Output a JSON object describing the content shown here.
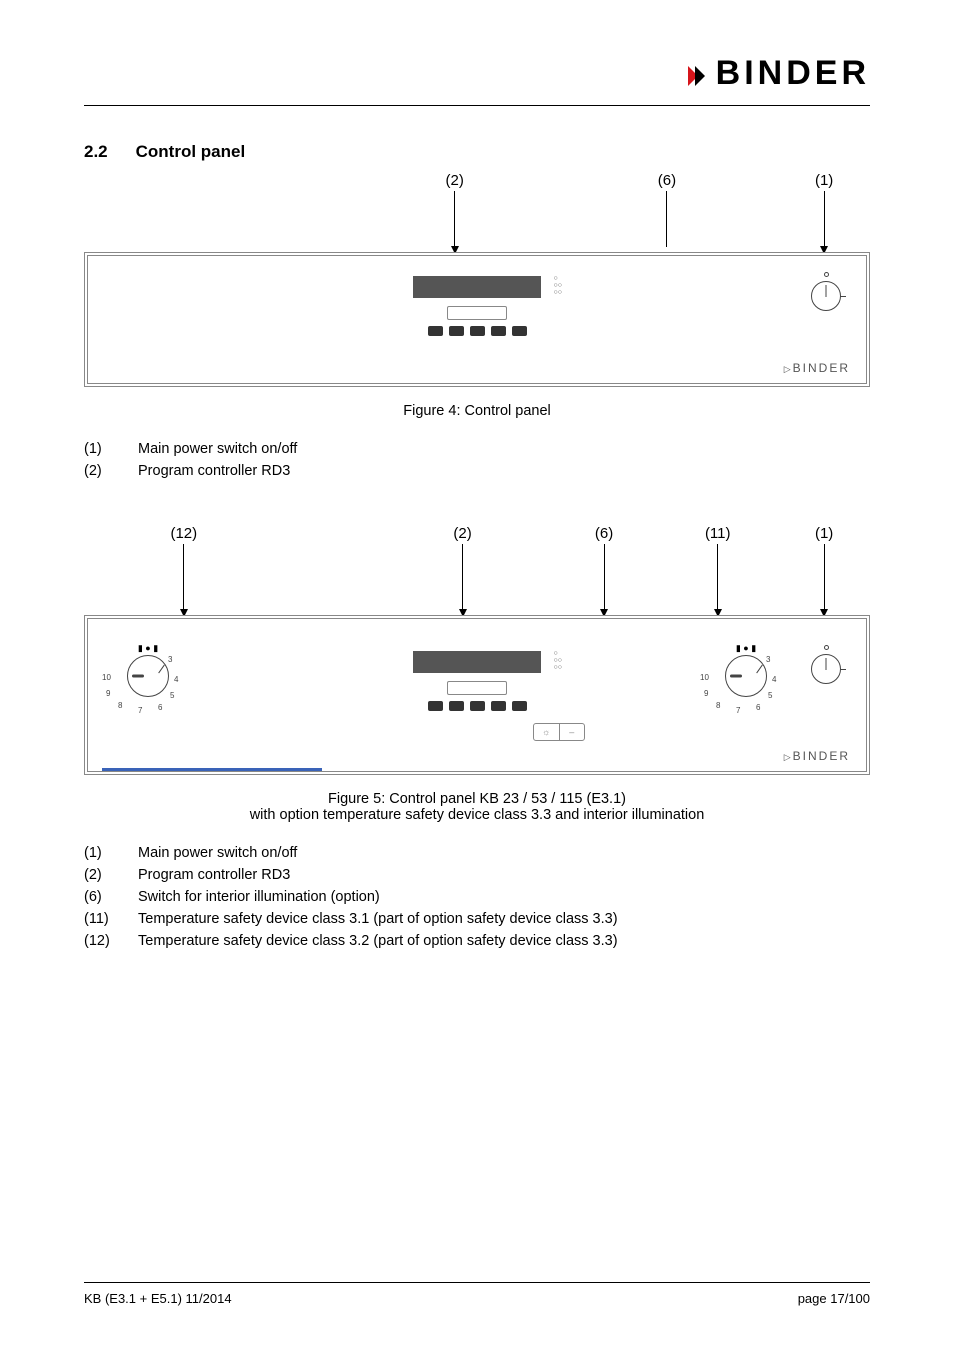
{
  "brand": "BINDER",
  "section": {
    "num": "2.2",
    "title": "Control panel"
  },
  "fig4": {
    "callouts": {
      "c2": "(2)",
      "c6": "(6)",
      "c1": "(1)"
    },
    "caption": "Figure 4: Control panel",
    "panel_brand": "BINDER"
  },
  "list1": {
    "i1": {
      "num": "(1)",
      "text": "Main power switch on/off"
    },
    "i2": {
      "num": "(2)",
      "text": "Program controller RD3"
    }
  },
  "fig5": {
    "callouts": {
      "c12": "(12)",
      "c2": "(2)",
      "c6": "(6)",
      "c11": "(11)",
      "c1": "(1)"
    },
    "caption_l1": "Figure 5: Control panel KB 23 / 53 / 115 (E3.1)",
    "caption_l2": "with option temperature safety device class 3.3 and interior illumination",
    "panel_brand": "BINDER"
  },
  "list2": {
    "i1": {
      "num": "(1)",
      "text": "Main power switch on/off"
    },
    "i2": {
      "num": "(2)",
      "text": "Program controller RD3"
    },
    "i6": {
      "num": "(6)",
      "text": "Switch for interior illumination (option)"
    },
    "i11": {
      "num": "(11)",
      "text": "Temperature safety device class 3.1 (part of option safety device class 3.3)"
    },
    "i12": {
      "num": "(12)",
      "text": "Temperature safety device class 3.2 (part of option safety device class 3.3)"
    }
  },
  "footer": {
    "left": "KB (E3.1 + E5.1) 11/2014",
    "right": "page 17/100"
  }
}
